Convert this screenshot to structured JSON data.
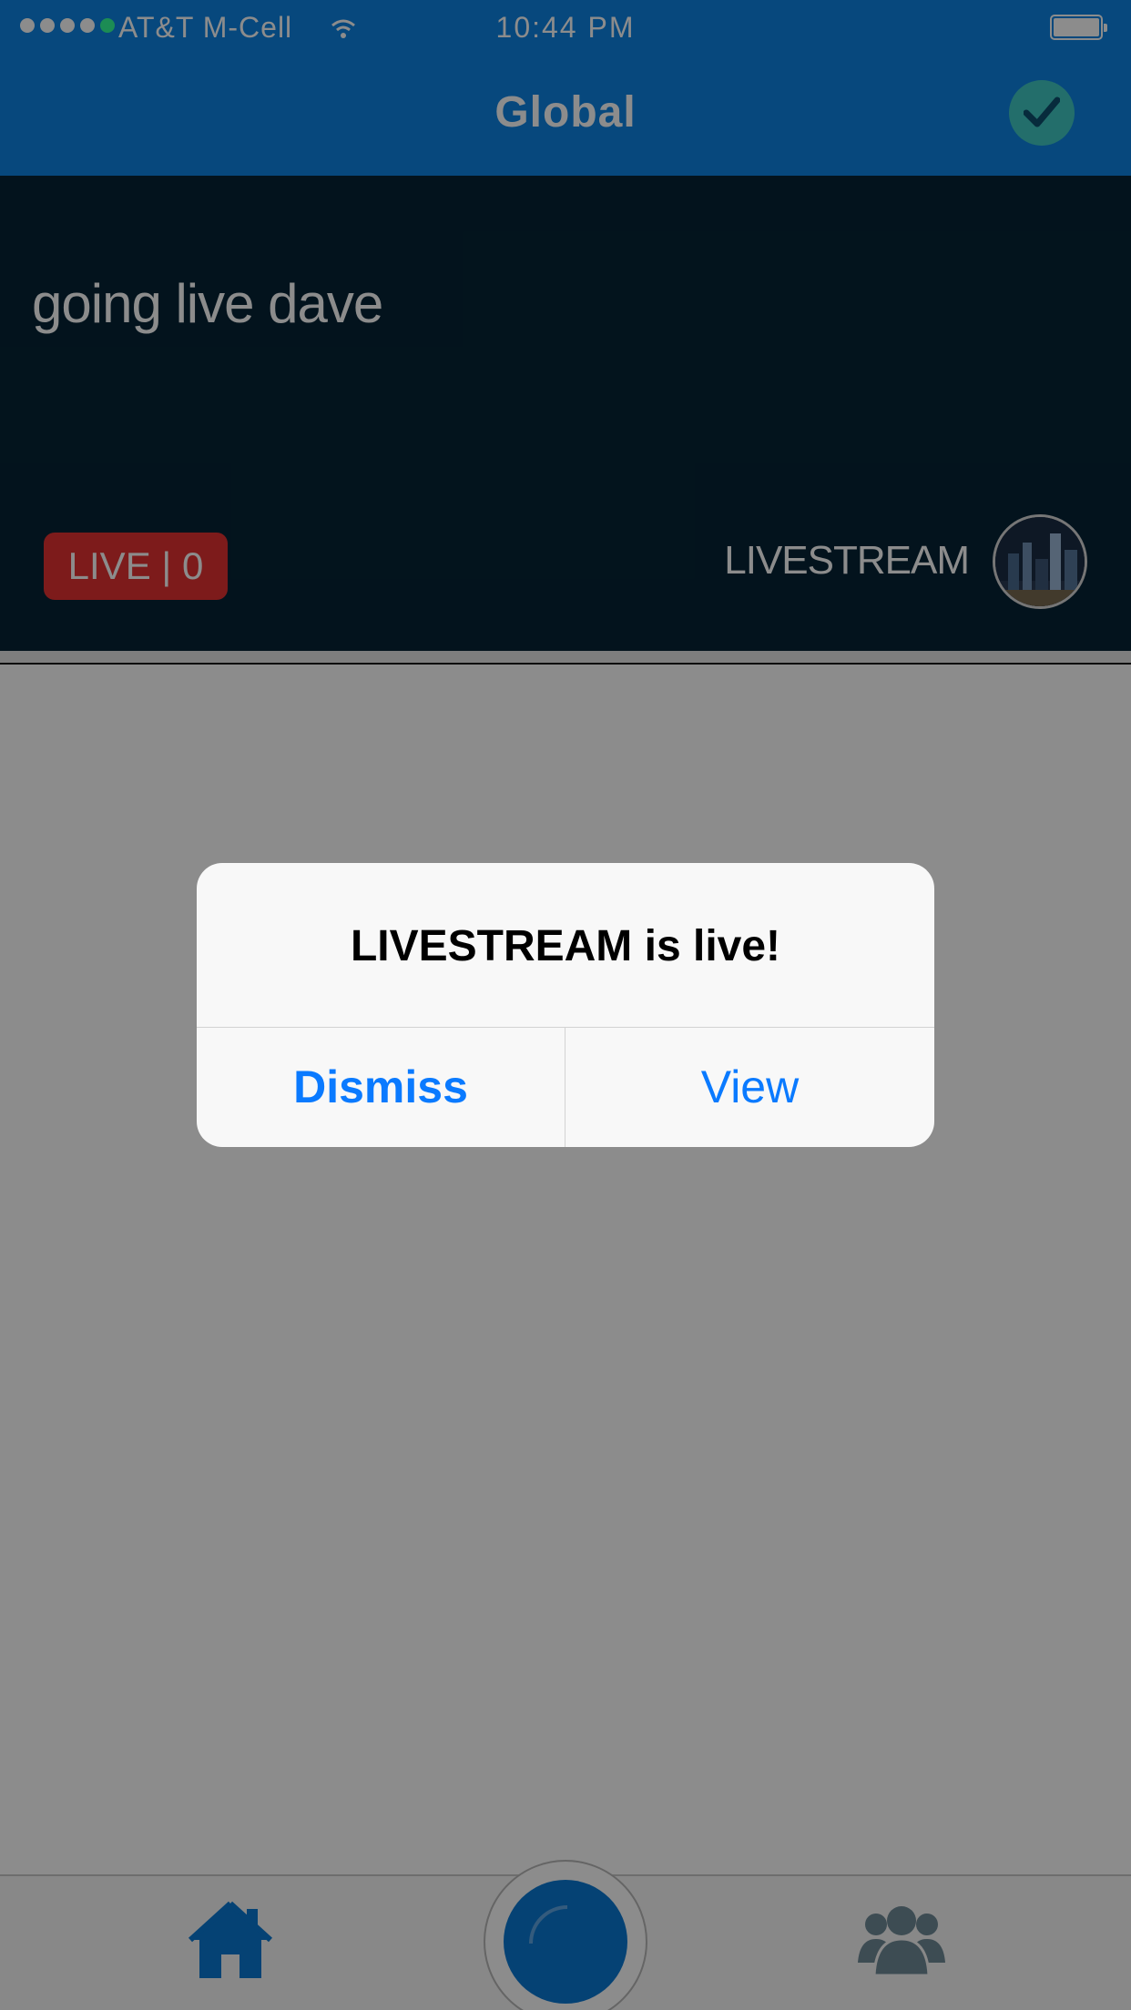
{
  "status_bar": {
    "carrier": "AT&T M-Cell",
    "time": "10:44 PM"
  },
  "nav": {
    "title": "Global"
  },
  "card": {
    "title": "going live dave",
    "live_badge": "LIVE | 0",
    "user": "LIVESTREAM"
  },
  "alert": {
    "title": "LIVESTREAM is live!",
    "dismiss_label": "Dismiss",
    "view_label": "View"
  },
  "tabbar": {
    "home_icon": "home-icon",
    "record_icon": "record-icon",
    "people_icon": "people-icon"
  },
  "colors": {
    "nav": "#0d84e4",
    "card": "#062435",
    "live": "#e33232",
    "check": "#41c8c4",
    "alert_button": "#0a7aff"
  }
}
